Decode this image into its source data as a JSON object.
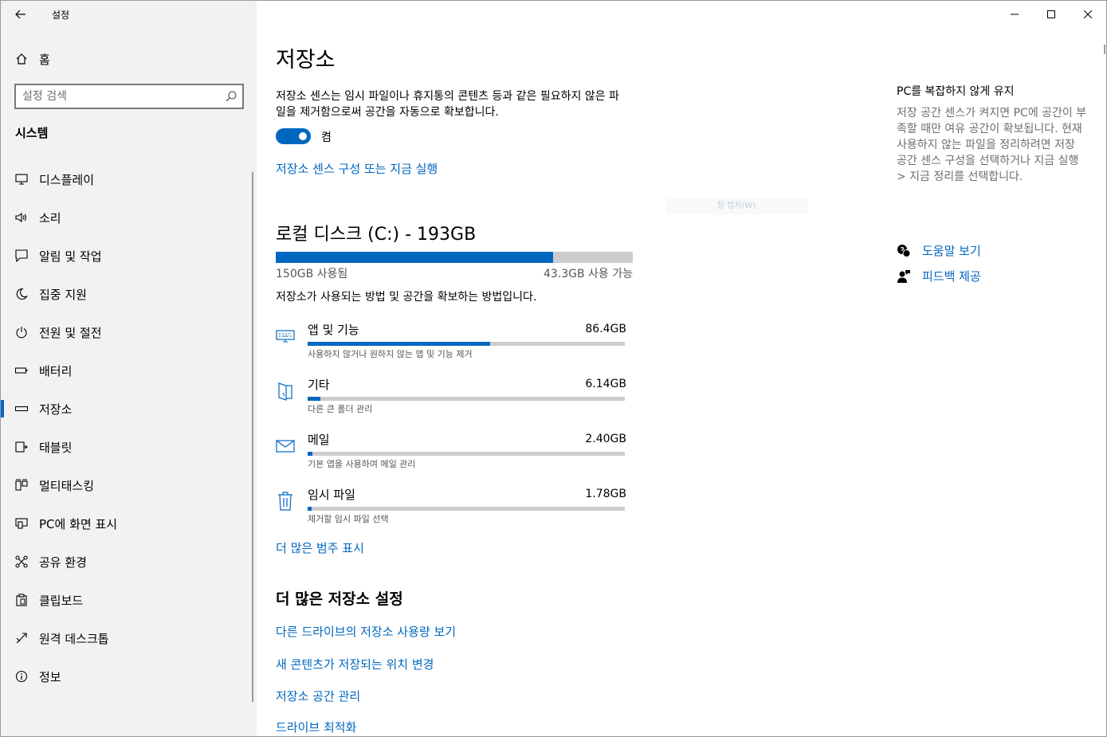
{
  "window": {
    "app_title": "설정",
    "controls": {
      "minimize": "minimize-icon",
      "maximize": "maximize-icon",
      "close": "close-icon"
    }
  },
  "sidebar": {
    "home_label": "홈",
    "search_placeholder": "설정 검색",
    "section_title": "시스템",
    "items": [
      {
        "label": "디스플레이",
        "icon": "display-icon"
      },
      {
        "label": "소리",
        "icon": "speaker-icon"
      },
      {
        "label": "알림 및 작업",
        "icon": "notification-icon"
      },
      {
        "label": "집중 지원",
        "icon": "moon-icon"
      },
      {
        "label": "전원 및 절전",
        "icon": "power-icon"
      },
      {
        "label": "배터리",
        "icon": "battery-icon"
      },
      {
        "label": "저장소",
        "icon": "storage-icon",
        "active": true
      },
      {
        "label": "태블릿",
        "icon": "tablet-icon"
      },
      {
        "label": "멀티태스킹",
        "icon": "multitasking-icon"
      },
      {
        "label": "PC에 화면 표시",
        "icon": "projecting-icon"
      },
      {
        "label": "공유 환경",
        "icon": "shared-experiences-icon"
      },
      {
        "label": "클립보드",
        "icon": "clipboard-icon"
      },
      {
        "label": "원격 데스크톱",
        "icon": "remote-desktop-icon"
      },
      {
        "label": "정보",
        "icon": "info-icon"
      }
    ]
  },
  "main": {
    "title": "저장소",
    "description": "저장소 센스는 임시 파일이나 휴지통의 콘텐츠 등과 같은 필요하지 않은 파일을 제거함으로써 공간을 자동으로 확보합니다.",
    "toggle_label": "켬",
    "toggle_on": true,
    "configure_link": "저장소 센스 구성 또는 지금 실행",
    "ghost_text": "창 캡처(W)",
    "disk": {
      "title": "로컬 디스크 (C:) - 193GB",
      "used_label": "150GB 사용됨",
      "free_label": "43.3GB 사용 가능",
      "used_fraction": 0.777,
      "description": "저장소가 사용되는 방법 및 공간을 확보하는 방법입니다."
    },
    "categories": [
      {
        "name": "앱 및 기능",
        "size": "86.4GB",
        "sub": "사용하지 않거나 원하지 않는 앱 및 기능 제거",
        "fraction": 0.576,
        "icon": "apps-icon"
      },
      {
        "name": "기타",
        "size": "6.14GB",
        "sub": "다른 큰 폴더 관리",
        "fraction": 0.04,
        "icon": "folder-icon"
      },
      {
        "name": "메일",
        "size": "2.40GB",
        "sub": "기본 앱을 사용하여 메일 관리",
        "fraction": 0.016,
        "icon": "mail-icon"
      },
      {
        "name": "임시 파일",
        "size": "1.78GB",
        "sub": "제거할 임시 파일 선택",
        "fraction": 0.012,
        "icon": "trash-icon"
      }
    ],
    "more_categories_link": "더 많은 범주 표시",
    "more_settings_title": "더 많은 저장소 설정",
    "more_links": [
      "다른 드라이브의 저장소 사용량 보기",
      "새 콘텐츠가 저장되는 위치 변경",
      "저장소 공간 관리",
      "드라이브 최적화"
    ]
  },
  "right": {
    "title": "PC를 복잡하지 않게 유지",
    "description": "저장 공간 센스가 켜지면 PC에 공간이 부족할 때만 여유 공간이 확보됩니다. 현재 사용하지 않는 파일을 정리하려면 저장 공간 센스 구성을 선택하거나 지금 실행 > 지금 정리를 선택합니다.",
    "help_link": "도움말 보기",
    "feedback_link": "피드백 제공"
  },
  "colors": {
    "accent": "#0067c0",
    "sidebar_bg": "#f2f2f2",
    "bar_bg": "#cccccc"
  }
}
